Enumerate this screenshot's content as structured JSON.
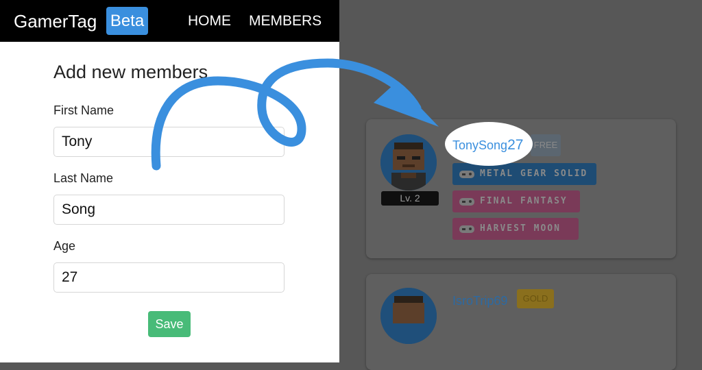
{
  "navbar": {
    "brand": "GamerTag",
    "badge": "Beta",
    "links": [
      "HOME",
      "MEMBERS"
    ]
  },
  "form": {
    "title": "Add new members",
    "first_name": {
      "label": "First Name",
      "value": "Tony"
    },
    "last_name": {
      "label": "Last Name",
      "value": "Song"
    },
    "age": {
      "label": "Age",
      "value": "27"
    },
    "save_label": "Save"
  },
  "members": [
    {
      "name": "TonySong",
      "age": "27",
      "plan": "FREE",
      "level": "Lv. 2",
      "games": [
        "METAL GEAR SOLID",
        "FINAL FANTASY",
        "HARVEST MOON"
      ]
    },
    {
      "name": "IsroTrip69",
      "plan": "GOLD"
    }
  ],
  "colors": {
    "accent": "#3a8fde",
    "save_button": "#48bb78",
    "overlay": "#575757",
    "tag_blue": "#1e4c74",
    "tag_pink": "#7a3a58",
    "plan_free": "#5b6670",
    "plan_gold": "#8a6f1d"
  },
  "icons": [
    "gamepad-icon",
    "curved-arrow-icon"
  ]
}
